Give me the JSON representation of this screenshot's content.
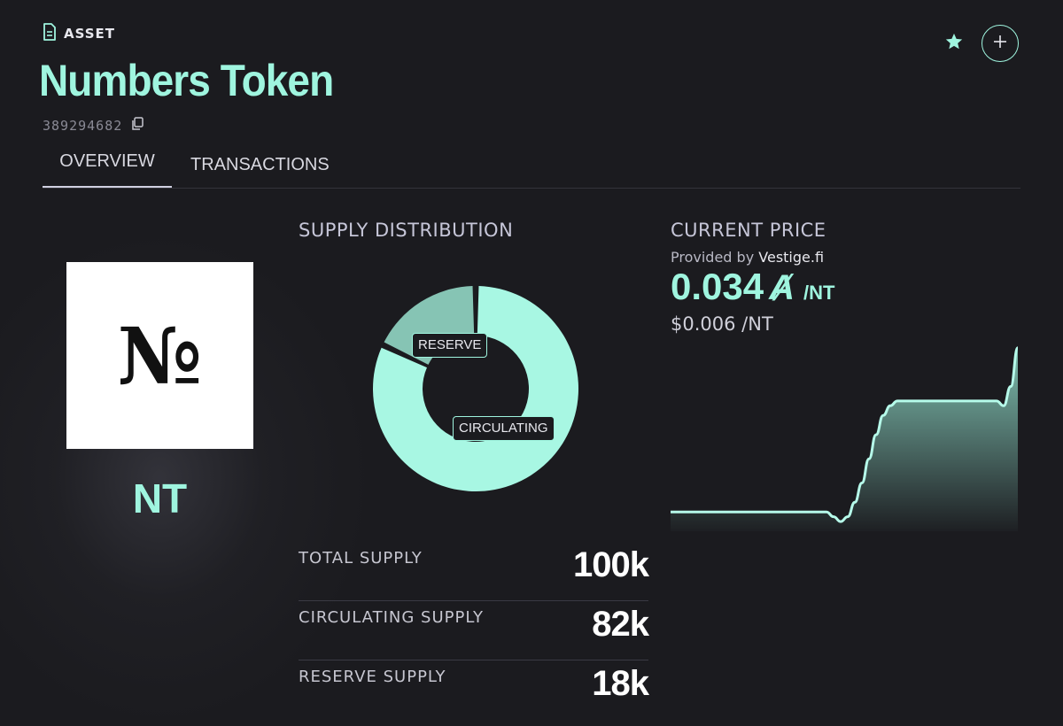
{
  "header": {
    "section_label": "ASSET",
    "title": "Numbers Token",
    "asset_id": "389294682"
  },
  "tabs": [
    {
      "label": "OVERVIEW",
      "active": true
    },
    {
      "label": "TRANSACTIONS",
      "active": false
    }
  ],
  "logo": {
    "glyph": "№"
  },
  "unit_name": "NT",
  "supply": {
    "title": "SUPPLY DISTRIBUTION",
    "chart_labels": {
      "reserve": "RESERVE",
      "circulating": "CIRCULATING"
    },
    "rows": [
      {
        "label": "TOTAL SUPPLY",
        "value": "100k"
      },
      {
        "label": "CIRCULATING SUPPLY",
        "value": "82k"
      },
      {
        "label": "RESERVE SUPPLY",
        "value": "18k"
      }
    ]
  },
  "price": {
    "title": "CURRENT PRICE",
    "provided_prefix": "Provided by",
    "provider": "Vestige.fi",
    "algo_value": "0.034",
    "algo_symbol": "Ⱥ",
    "unit": "/NT",
    "usd_value": "$0.006 /NT"
  },
  "colors": {
    "accent": "#9ff5df",
    "reserve": "#86c4b4",
    "background": "#1b1b1f"
  },
  "icons": {
    "asset": "document-icon",
    "copy": "copy-icon",
    "favorite": "star-icon",
    "add": "plus-icon"
  },
  "chart_data": [
    {
      "type": "pie",
      "donut": true,
      "labels": [
        "CIRCULATING",
        "RESERVE"
      ],
      "values": [
        82,
        18
      ],
      "colors": [
        "#a8f7e3",
        "#86c4b4"
      ]
    },
    {
      "type": "area",
      "values": [
        0.0,
        0.0,
        0.0,
        0.0,
        0.0,
        0.0,
        0.0,
        0.0,
        0.0,
        0.0,
        0.0,
        0.0,
        0.0,
        0.0,
        0.0,
        0.0,
        0.0,
        0.0,
        0.0,
        0.0,
        0.0,
        0.0,
        0.0,
        -0.001,
        -0.002,
        -0.001,
        0.002,
        0.006,
        0.011,
        0.016,
        0.02,
        0.022,
        0.023,
        0.023,
        0.023,
        0.023,
        0.023,
        0.023,
        0.023,
        0.023,
        0.023,
        0.023,
        0.023,
        0.023,
        0.023,
        0.023,
        0.023,
        0.022,
        0.026,
        0.034
      ],
      "ylim": [
        -0.004,
        0.036
      ],
      "grid": false
    }
  ]
}
